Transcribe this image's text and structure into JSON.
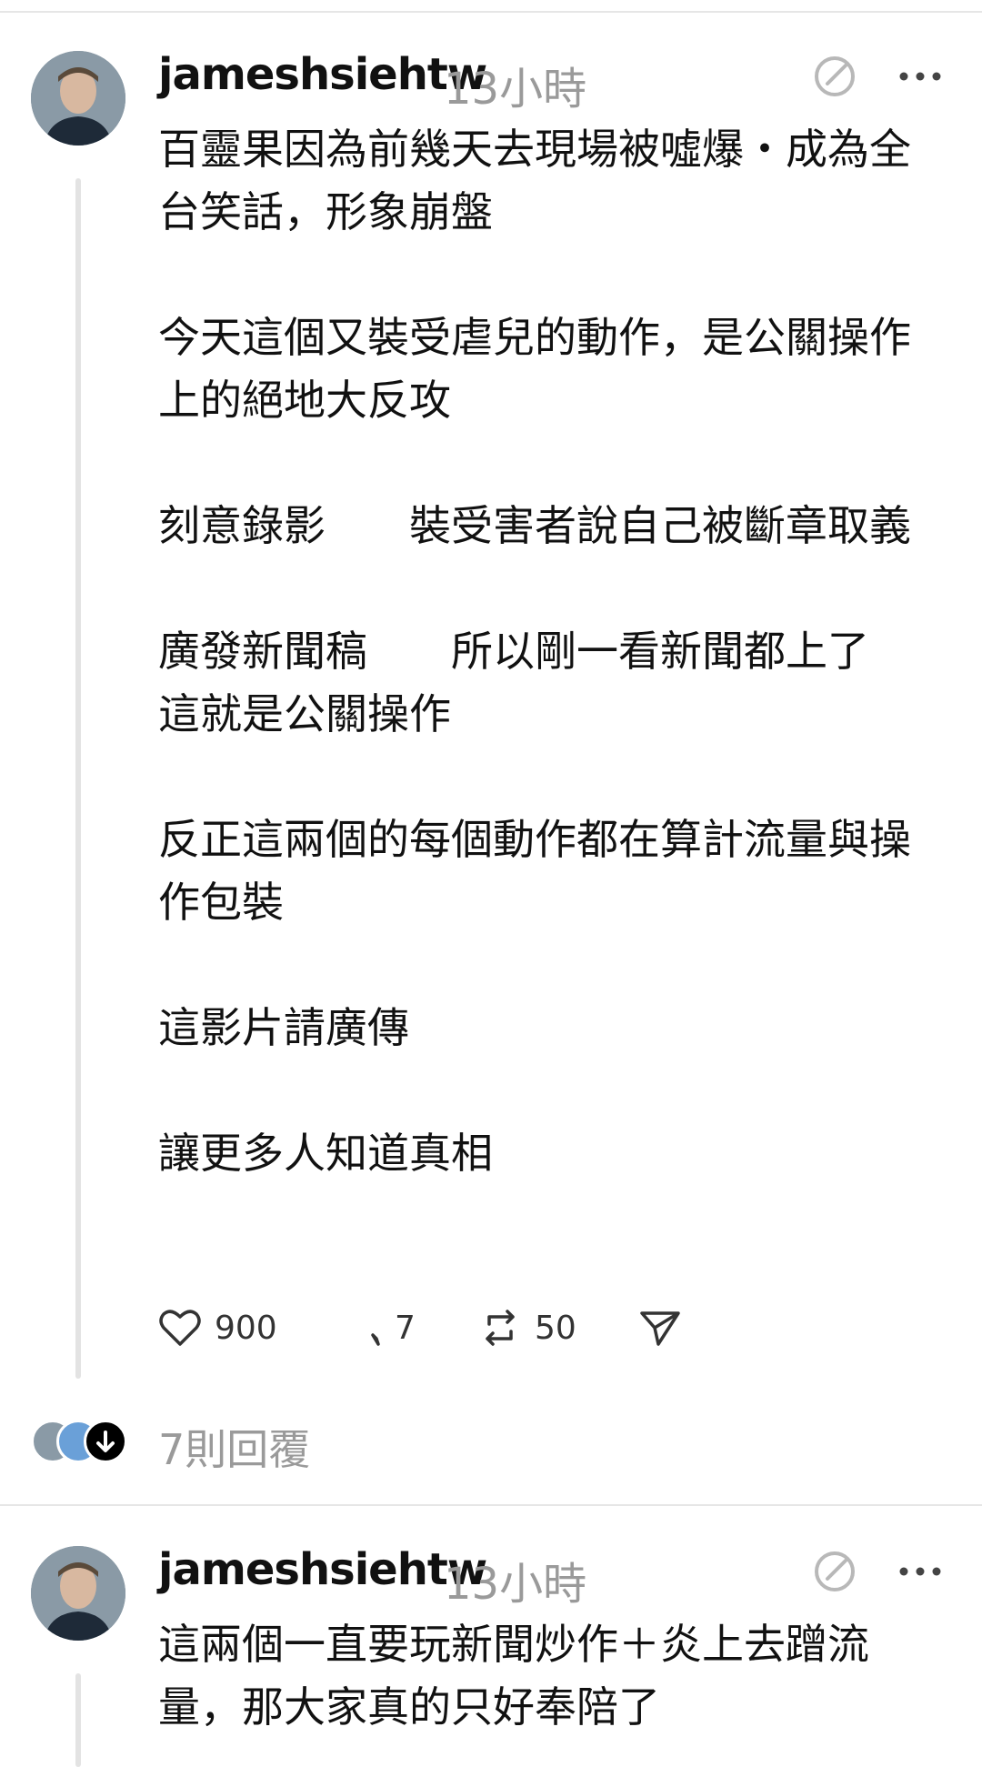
{
  "post1": {
    "username": "jameshsiehtw",
    "time": "13小時",
    "body": "百靈果因為前幾天去現場被噓爆・成為全台笑話，形象崩盤\n\n今天這個又裝受虐兒的動作，是公關操作上的絕地大反攻\n\n刻意錄影　　裝受害者說自己被斷章取義\n\n廣發新聞稿　　所以剛一看新聞都上了\n這就是公關操作\n\n反正這兩個的每個動作都在算計流量與操作包裝\n\n這影片請廣傳\n\n讓更多人知道真相",
    "likes": "900",
    "comments": "7",
    "reposts": "50"
  },
  "replies_label": "7則回覆",
  "post2": {
    "username": "jameshsiehtw",
    "time": "13小時",
    "body": "這兩個一直要玩新聞炒作＋炎上去蹭流量，那大家真的只好奉陪了"
  },
  "icons": {
    "avatar": "profile-photo",
    "edit": "edit-circle-icon",
    "more": "more-dots-icon",
    "like": "heart-icon",
    "comment": "comment-icon",
    "repost": "repost-icon",
    "share": "send-icon"
  }
}
